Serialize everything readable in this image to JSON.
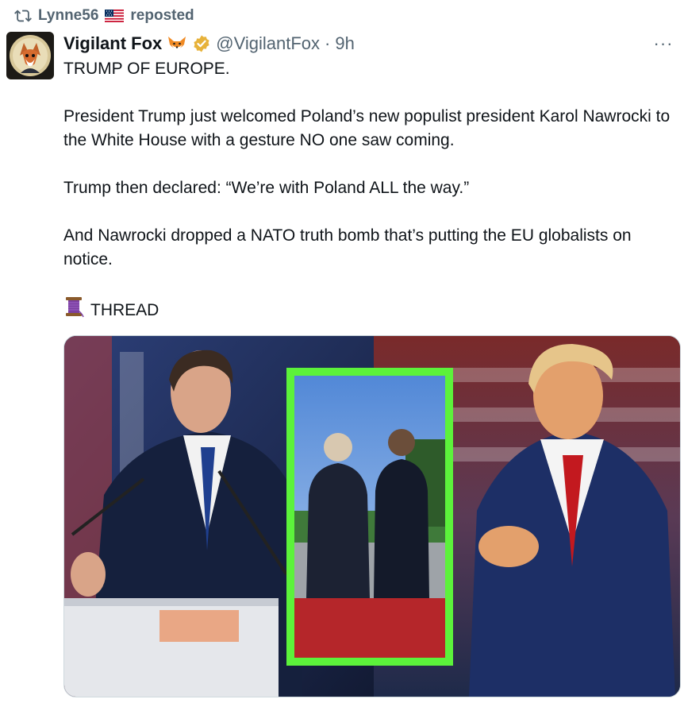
{
  "repost": {
    "username": "Lynne56",
    "action": "reposted",
    "icon": "repost-icon",
    "flag_icon": "us-flag-icon"
  },
  "author": {
    "name": "Vigilant Fox",
    "handle": "@VigilantFox",
    "separator": "·",
    "time": "9h",
    "name_emoji_icon": "fox-face-icon",
    "verified_icon": "gold-verified-badge-icon",
    "verified_color": "#e7b23a"
  },
  "more_label": "···",
  "post": {
    "line1": "TRUMP OF EUROPE.",
    "para1": "President Trump just welcomed Poland’s new populist president Karol Nawrocki to the White House with a gesture NO one saw coming.",
    "para2": "Trump then declared: “We’re with Poland ALL the way.”",
    "para3": "And Nawrocki dropped a NATO truth bomb that’s putting the EU globalists on notice.",
    "thread_label": "THREAD",
    "thread_icon": "spool-of-thread-icon"
  },
  "media": {
    "icon": "photo-collage",
    "highlight_color": "#5cf23b"
  }
}
